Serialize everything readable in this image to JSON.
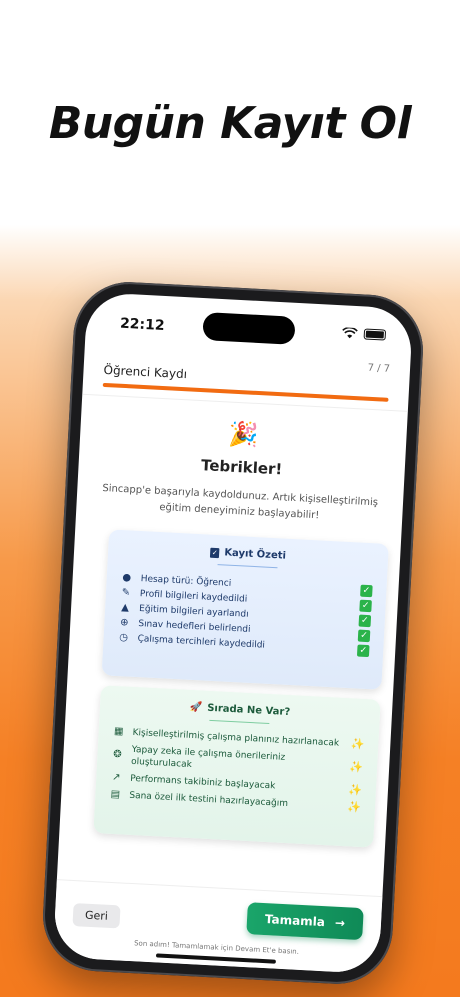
{
  "headline": "Bugün Kayıt Ol",
  "status_bar": {
    "time": "22:12"
  },
  "registration": {
    "title": "Öğrenci Kaydı",
    "step": "7 / 7",
    "progress": 1.0
  },
  "congrats": {
    "emoji": "🎉",
    "title": "Tebrikler!",
    "message": "Sincapp'e başarıyla kaydoldunuz. Artık kişiselleştirilmiş eğitim deneyiminiz başlayabilir!"
  },
  "summary_card": {
    "title": "Kayıt Özeti",
    "items": [
      {
        "icon": "person-icon",
        "label": "Hesap türü: Öğrenci"
      },
      {
        "icon": "profile-edit-icon",
        "label": "Profil bilgileri kaydedildi"
      },
      {
        "icon": "graduation-cap-icon",
        "label": "Eğitim bilgileri ayarlandı"
      },
      {
        "icon": "target-icon",
        "label": "Sınav hedefleri belirlendi"
      },
      {
        "icon": "clock-icon",
        "label": "Çalışma tercihleri kaydedildi"
      }
    ]
  },
  "next_card": {
    "title": "Sırada Ne Var?",
    "items": [
      {
        "icon": "calendar-clock-icon",
        "label": "Kişiselleştirilmiş çalışma planınız hazırlanacak"
      },
      {
        "icon": "ai-psychology-icon",
        "label": "Yapay zeka ile çalışma önerileriniz oluşturulacak"
      },
      {
        "icon": "chart-icon",
        "label": "Performans takibiniz başlayacak"
      },
      {
        "icon": "document-edit-icon",
        "label": "Sana özel ilk testini hazırlayacağım"
      }
    ]
  },
  "buttons": {
    "back": "Geri",
    "done": "Tamamla",
    "done_arrow": "→"
  },
  "hint": "Son adım! Tamamlamak için Devam Et'e basın.",
  "colors": {
    "accent_orange": "#f26b11",
    "done_green": "#0f8a57",
    "summary_bg": "#eaf2ff",
    "next_bg": "#edf9f1"
  }
}
